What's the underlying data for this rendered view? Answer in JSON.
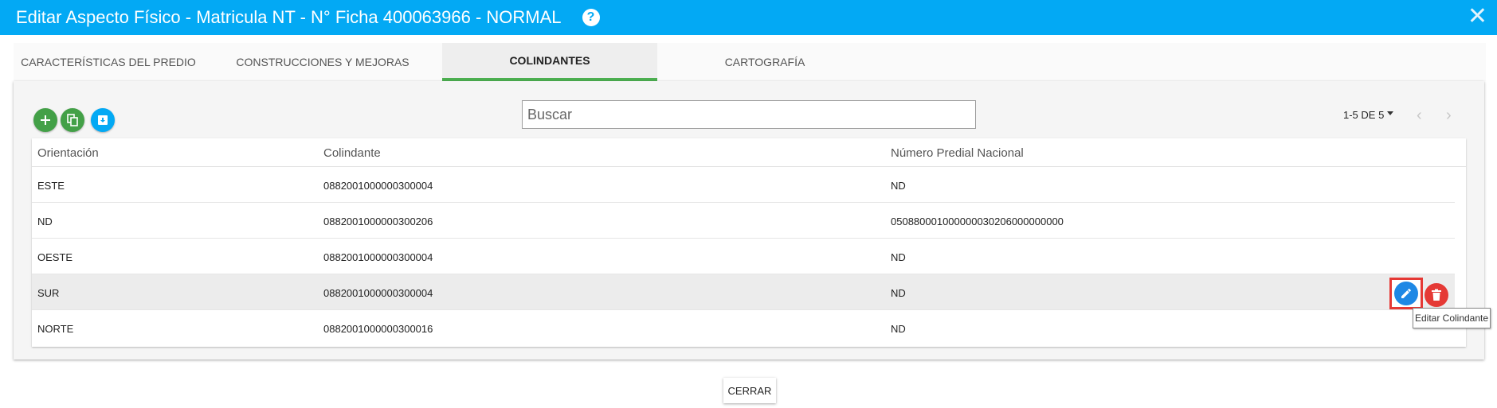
{
  "window": {
    "title": "Editar Aspecto Físico - Matricula NT - N° Ficha 400063966 - NORMAL",
    "help_icon": "?",
    "close_icon": "✕"
  },
  "tabs": [
    {
      "label": "CARACTERÍSTICAS DEL PREDIO",
      "active": false
    },
    {
      "label": "CONSTRUCCIONES Y MEJORAS",
      "active": false
    },
    {
      "label": "COLINDANTES",
      "active": true
    },
    {
      "label": "CARTOGRAFÍA",
      "active": false
    }
  ],
  "toolbar": {
    "icons": [
      "add-icon",
      "copy-icon",
      "archive-icon"
    ]
  },
  "search": {
    "placeholder": "Buscar",
    "value": ""
  },
  "pagination": {
    "label": "1-5 DE 5",
    "prev_icon": "‹",
    "next_icon": "›"
  },
  "table": {
    "headers": [
      "Orientación",
      "Colindante",
      "Número Predial Nacional"
    ],
    "rows": [
      [
        "ESTE",
        "0882001000000300004",
        "ND"
      ],
      [
        "ND",
        "0882001000000300206",
        "050880001000000030206000000000"
      ],
      [
        "OESTE",
        "0882001000000300004",
        "ND"
      ],
      [
        "SUR",
        "0882001000000300004",
        "ND"
      ],
      [
        "NORTE",
        "0882001000000300016",
        "ND"
      ]
    ],
    "highlighted_row": 3
  },
  "row_actions": {
    "edit_icon": "pencil-icon",
    "delete_icon": "trash-icon",
    "tooltip": "Editar Colindante"
  },
  "footer": {
    "close_label": "CERRAR"
  },
  "colors": {
    "titlebar": "#03a9f4",
    "active_tab_indicator": "#4caf50",
    "fab_green": "#43a047",
    "edit_blue": "#1e88e5",
    "delete_red": "#e53935"
  }
}
